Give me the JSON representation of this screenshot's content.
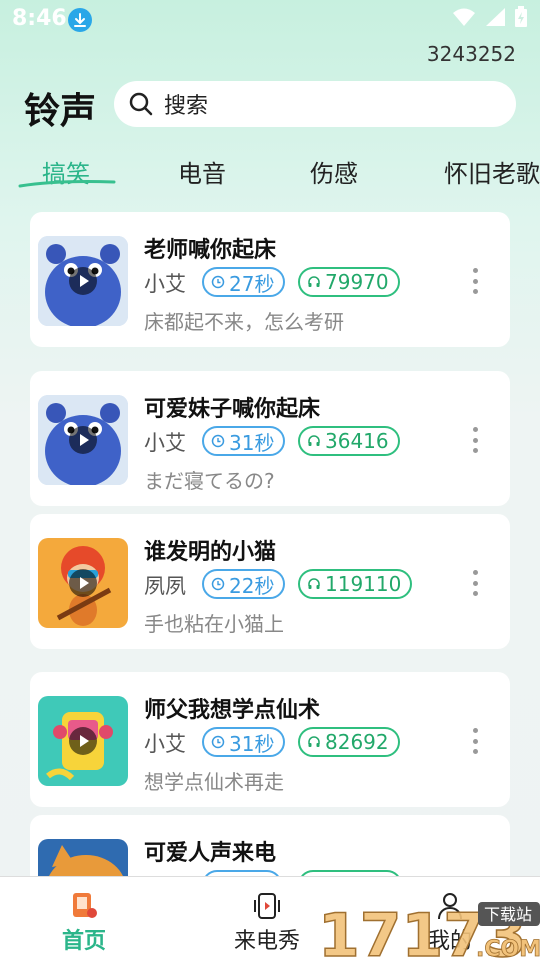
{
  "status_bar": {
    "time": "8:46"
  },
  "header": {
    "user_id": "3243252",
    "app_title": "铃声"
  },
  "search": {
    "placeholder": "搜索"
  },
  "tabs": [
    {
      "label": "搞笑",
      "active": true
    },
    {
      "label": "电音"
    },
    {
      "label": "伤感"
    },
    {
      "label": "怀旧老歌"
    }
  ],
  "ringtones": [
    {
      "title": "老师喊你起床",
      "author": "小艾",
      "duration": "27秒",
      "plays": "79970",
      "desc": "床都起不来，怎么考研",
      "thumb": "blue-monster"
    },
    {
      "title": "可爱妹子喊你起床",
      "author": "小艾",
      "duration": "31秒",
      "plays": "36416",
      "desc": "まだ寝てるの?",
      "thumb": "blue-monster"
    },
    {
      "title": "谁发明的小猫",
      "author": "夙夙",
      "duration": "22秒",
      "plays": "119110",
      "desc": "手也粘在小猫上",
      "thumb": "guitar-cat"
    },
    {
      "title": "师父我想学点仙术",
      "author": "小艾",
      "duration": "31秒",
      "plays": "82692",
      "desc": "想学点仙术再走",
      "thumb": "yellow-robot"
    },
    {
      "title": "可爱人声来电",
      "author": "",
      "duration": "",
      "plays": "",
      "desc": "",
      "thumb": "orange-cat"
    }
  ],
  "bottom_nav": [
    {
      "label": "首页",
      "icon": "home-phone-icon",
      "active": true
    },
    {
      "label": "来电秀",
      "icon": "video-call-icon"
    },
    {
      "label": "我的",
      "icon": "profile-icon"
    }
  ],
  "watermark": {
    "text": "17173",
    "badge": "下载站",
    "domain": ".COM"
  },
  "colors": {
    "accent": "#2bb58a",
    "duration_pill": "#3a9be0",
    "plays_pill": "#22a86a"
  }
}
